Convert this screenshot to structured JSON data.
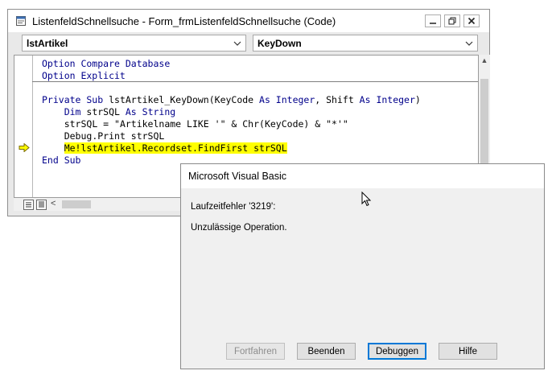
{
  "code_window": {
    "title": "ListenfeldSchnellsuche - Form_frmListenfeldSchnellsuche (Code)",
    "object_combo": "lstArtikel",
    "procedure_combo": "KeyDown"
  },
  "code_lines": [
    {
      "indent": "",
      "parts": [
        {
          "t": "Option Compare Database",
          "c": "kw"
        }
      ]
    },
    {
      "indent": "",
      "parts": [
        {
          "t": "Option Explicit",
          "c": "kw"
        }
      ]
    },
    {
      "indent": "",
      "parts": []
    },
    {
      "indent": "",
      "parts": [
        {
          "t": "Private Sub ",
          "c": "kw"
        },
        {
          "t": "lstArtikel_KeyDown(KeyCode ",
          "c": "tx"
        },
        {
          "t": "As Integer",
          "c": "kw"
        },
        {
          "t": ", Shift ",
          "c": "tx"
        },
        {
          "t": "As Integer",
          "c": "kw"
        },
        {
          "t": ")",
          "c": "tx"
        }
      ]
    },
    {
      "indent": "    ",
      "parts": [
        {
          "t": "Dim ",
          "c": "kw"
        },
        {
          "t": "strSQL ",
          "c": "tx"
        },
        {
          "t": "As String",
          "c": "kw"
        }
      ]
    },
    {
      "indent": "    ",
      "parts": [
        {
          "t": "strSQL = \"Artikelname LIKE '\" & Chr(KeyCode) & \"*'\"",
          "c": "tx"
        }
      ]
    },
    {
      "indent": "    ",
      "parts": [
        {
          "t": "Debug.Print strSQL",
          "c": "tx"
        }
      ]
    },
    {
      "indent": "    ",
      "parts": [
        {
          "t": "Me!lstArtikel.Recordset.FindFirst strSQL",
          "c": "tx"
        }
      ],
      "highlight": true
    },
    {
      "indent": "",
      "parts": [
        {
          "t": "End Sub",
          "c": "kw"
        }
      ]
    }
  ],
  "dialog": {
    "title": "Microsoft Visual Basic",
    "error_line": "Laufzeitfehler '3219':",
    "message": "Unzulässige Operation.",
    "buttons": {
      "continue": "Fortfahren",
      "end": "Beenden",
      "debug": "Debuggen",
      "help": "Hilfe"
    }
  },
  "colors": {
    "keyword": "#00008b",
    "highlight": "#ffff00",
    "arrow": "#e0c000",
    "default_button_border": "#0078d7"
  }
}
